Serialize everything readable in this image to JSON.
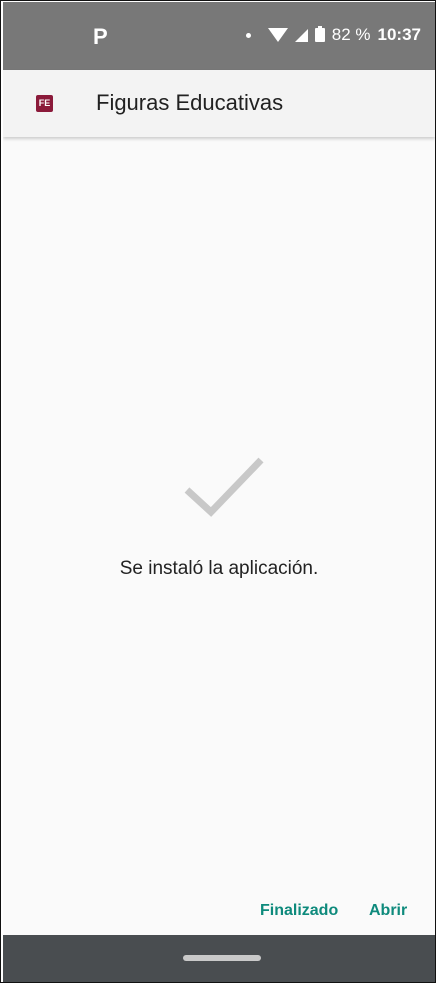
{
  "status_bar": {
    "app_indicator": "P",
    "battery": "82 %",
    "time": "10:37"
  },
  "app_bar": {
    "icon_text": "FE",
    "title": "Figuras Educativas"
  },
  "content": {
    "message": "Se instaló la aplicación."
  },
  "buttons": {
    "done": "Finalizado",
    "open": "Abrir"
  },
  "colors": {
    "status_bar": "#787878",
    "accent": "#0e8a7c",
    "app_icon": "#8b1a3a",
    "nav_bar": "#494d50"
  }
}
